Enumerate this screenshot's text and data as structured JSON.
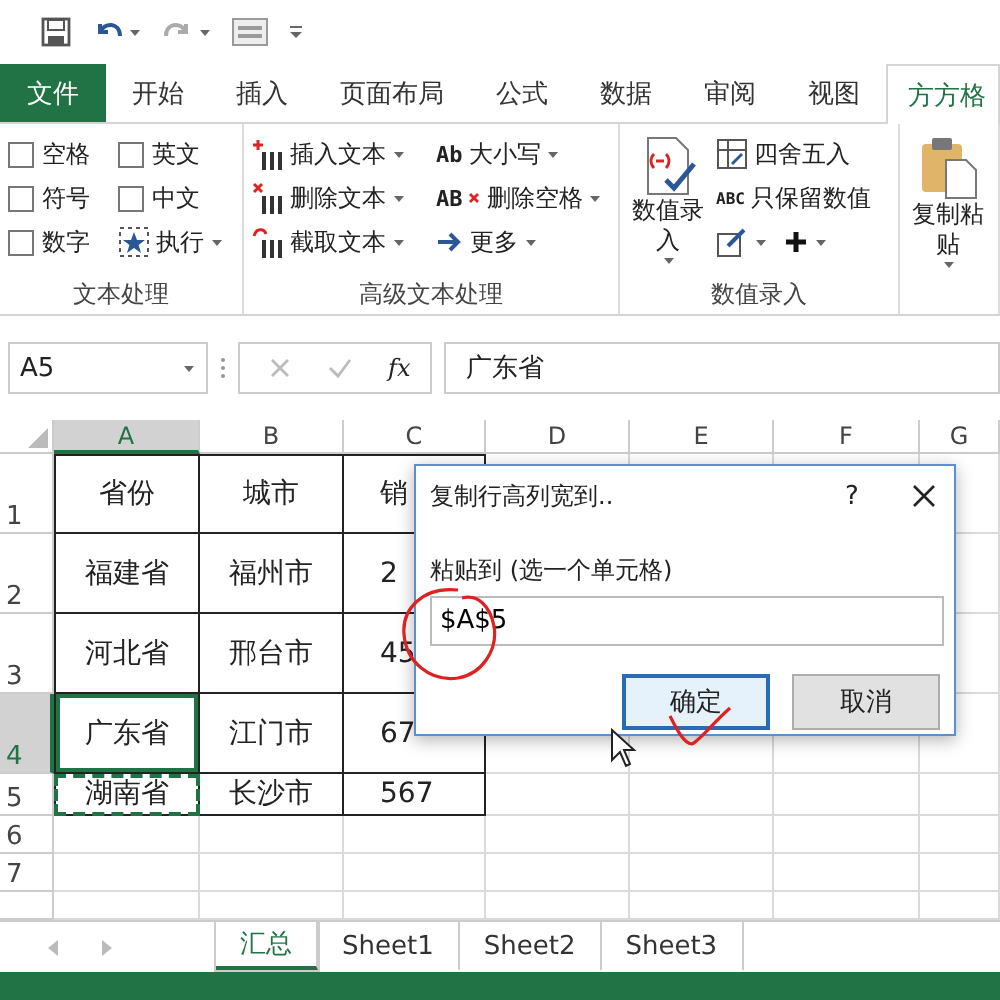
{
  "ribbon_tabs": [
    {
      "label": "文件",
      "kind": "file",
      "selected": false
    },
    {
      "label": "开始",
      "kind": "tab",
      "selected": false
    },
    {
      "label": "插入",
      "kind": "tab",
      "selected": false
    },
    {
      "label": "页面布局",
      "kind": "tab",
      "selected": false
    },
    {
      "label": "公式",
      "kind": "tab",
      "selected": false
    },
    {
      "label": "数据",
      "kind": "tab",
      "selected": false
    },
    {
      "label": "审阅",
      "kind": "tab",
      "selected": false
    },
    {
      "label": "视图",
      "kind": "tab",
      "selected": false
    },
    {
      "label": "方方格",
      "kind": "tab",
      "selected": true
    }
  ],
  "ribbon_groups": [
    {
      "kind": "checkbox-grid",
      "label": "文本处理",
      "items": [
        {
          "kind": "checkbox",
          "label": "空格",
          "checked": false
        },
        {
          "kind": "checkbox",
          "label": "英文",
          "checked": false
        },
        {
          "kind": "checkbox",
          "label": "符号",
          "checked": false
        },
        {
          "kind": "checkbox",
          "label": "中文",
          "checked": false
        },
        {
          "kind": "checkbox",
          "label": "数字",
          "checked": false
        },
        {
          "kind": "button",
          "label": "执行",
          "dropdown": true
        }
      ]
    },
    {
      "kind": "button-columns",
      "label": "高级文本处理",
      "items": [
        {
          "kind": "button",
          "label": "插入文本",
          "dropdown": true
        },
        {
          "kind": "button",
          "label": "删除文本",
          "dropdown": true
        },
        {
          "kind": "button",
          "label": "截取文本",
          "dropdown": true
        },
        {
          "kind": "button",
          "label": "大小写",
          "icon_text": "Ab",
          "dropdown": true
        },
        {
          "kind": "button",
          "label": "删除空格",
          "icon_text": "AB",
          "dropdown": true
        },
        {
          "kind": "button",
          "label": "更多",
          "dropdown": true
        }
      ]
    },
    {
      "kind": "mixed",
      "label": "数值录入",
      "items": [
        {
          "kind": "large-button",
          "label": "数值录入",
          "dropdown": true
        },
        {
          "kind": "button",
          "label": "四舍五入",
          "dropdown": false
        },
        {
          "kind": "button",
          "label": "只保留数值",
          "icon_text": "ABC",
          "dropdown": false
        },
        {
          "kind": "icon-button",
          "dropdown": true
        },
        {
          "kind": "icon-button",
          "dropdown": true
        }
      ]
    },
    {
      "kind": "large",
      "items": [
        {
          "kind": "large-button",
          "label": "复制粘贴",
          "dropdown": true
        }
      ]
    }
  ],
  "formula_bar": {
    "name_box": "A5",
    "fx_label": "fx",
    "value": "广东省"
  },
  "sheet": {
    "columns": [
      "A",
      "B",
      "C",
      "D",
      "E",
      "F",
      "G"
    ],
    "rows": [
      {
        "number": "1",
        "cells": [
          {
            "text": "省份",
            "selected": false,
            "copied": false
          },
          {
            "text": "城市",
            "selected": false,
            "copied": false
          },
          {
            "text": "销",
            "selected": false,
            "copied": false
          }
        ]
      },
      {
        "number": "2",
        "cells": [
          {
            "text": "福建省",
            "selected": false,
            "copied": false
          },
          {
            "text": "福州市",
            "selected": false,
            "copied": false
          },
          {
            "text": "2",
            "selected": false,
            "copied": false
          }
        ]
      },
      {
        "number": "3",
        "cells": [
          {
            "text": "河北省",
            "selected": false,
            "copied": false
          },
          {
            "text": "邢台市",
            "selected": false,
            "copied": false
          },
          {
            "text": "45",
            "selected": false,
            "copied": false
          }
        ]
      },
      {
        "number": "4",
        "cells": [
          {
            "text": "广东省",
            "selected": true,
            "copied": false
          },
          {
            "text": "江门市",
            "selected": false,
            "copied": false
          },
          {
            "text": "67",
            "selected": false,
            "copied": false
          }
        ]
      },
      {
        "number": "5",
        "cells": [
          {
            "text": "湖南省",
            "selected": false,
            "copied": true
          },
          {
            "text": "长沙市",
            "selected": false,
            "copied": false
          },
          {
            "text": "567",
            "selected": false,
            "copied": false
          }
        ]
      },
      {
        "number": "6",
        "cells": []
      },
      {
        "number": "7",
        "cells": []
      }
    ]
  },
  "sheet_tabs": [
    {
      "label": "汇总",
      "selected": true
    },
    {
      "label": "Sheet1",
      "selected": false
    },
    {
      "label": "Sheet2",
      "selected": false
    },
    {
      "label": "Sheet3",
      "selected": false
    }
  ],
  "dialog": {
    "title": "复制行高列宽到..",
    "help": "?",
    "field_label": "粘贴到 (选一个单元格)",
    "value": "$A$5",
    "buttons": [
      {
        "label": "确定",
        "default": true
      },
      {
        "label": "取消",
        "default": false
      }
    ]
  }
}
